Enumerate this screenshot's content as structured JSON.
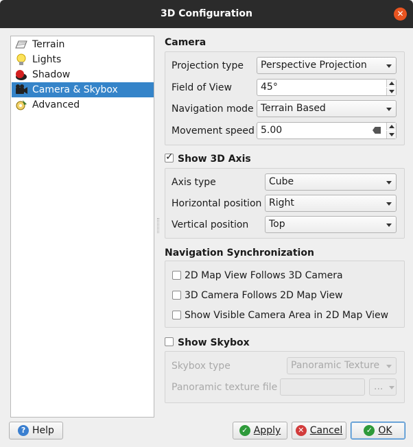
{
  "window": {
    "title": "3D Configuration",
    "close_symbol": "✕"
  },
  "nav": {
    "items": [
      {
        "label": "Terrain",
        "icon": "terrain-icon"
      },
      {
        "label": "Lights",
        "icon": "bulb-icon"
      },
      {
        "label": "Shadow",
        "icon": "shadow-icon"
      },
      {
        "label": "Camera & Skybox",
        "icon": "camera-icon",
        "selected": true
      },
      {
        "label": "Advanced",
        "icon": "advanced-icon"
      }
    ]
  },
  "camera": {
    "title": "Camera",
    "projection_label": "Projection type",
    "projection_value": "Perspective Projection",
    "fov_label": "Field of View",
    "fov_value": "45°",
    "navmode_label": "Navigation mode",
    "navmode_value": "Terrain Based",
    "speed_label": "Movement speed",
    "speed_value": "5.00"
  },
  "axis": {
    "title": "Show 3D Axis",
    "checked": true,
    "type_label": "Axis type",
    "type_value": "Cube",
    "hpos_label": "Horizontal position",
    "hpos_value": "Right",
    "vpos_label": "Vertical position",
    "vpos_value": "Top"
  },
  "navsync": {
    "title": "Navigation Synchronization",
    "opt1": "2D Map View Follows 3D Camera",
    "opt2": "3D Camera Follows 2D Map View",
    "opt3": "Show Visible Camera Area in 2D Map View"
  },
  "skybox": {
    "title": "Show Skybox",
    "checked": false,
    "type_label": "Skybox type",
    "type_value": "Panoramic Texture",
    "file_label": "Panoramic texture file",
    "browse_label": "..."
  },
  "buttons": {
    "help": "Help",
    "apply": "Apply",
    "cancel": "Cancel",
    "ok": "OK"
  },
  "colors": {
    "selection": "#3584c9",
    "close": "#e95420",
    "apply_icon": "#2e9a3a",
    "cancel_icon": "#d23b3b",
    "help_icon": "#3a7fd0"
  }
}
